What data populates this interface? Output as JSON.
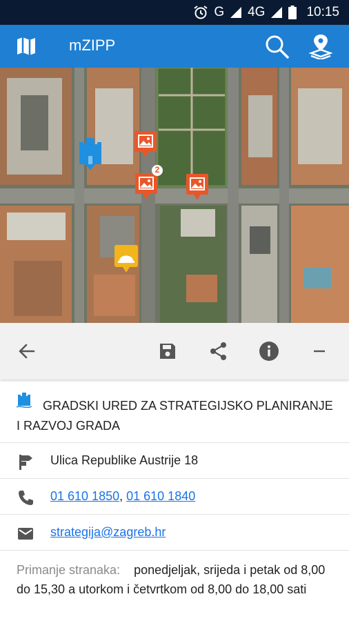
{
  "status_bar": {
    "network_g": "G",
    "network_4g": "4G",
    "time": "10:15"
  },
  "app_bar": {
    "title": "mZIPP",
    "icons": [
      "map-icon",
      "search-icon",
      "location-pin-icon"
    ]
  },
  "map": {
    "cluster_count": "2",
    "markers": [
      "building-marker-icon",
      "photo-marker-icon",
      "photo-cluster-marker-icon",
      "photo-marker-icon",
      "helmet-marker-icon"
    ]
  },
  "toolbar": {
    "icons": [
      "back-arrow-icon",
      "save-icon",
      "share-icon",
      "info-icon",
      "minimize-icon"
    ]
  },
  "details": {
    "org_name": "GRADSKI URED ZA STRATEGIJSKO PLANIRANJE I RAZVOJ GRADA",
    "address": "Ulica Republike Austrije 18",
    "phone_1": "01 610 1850",
    "phone_separator": ", ",
    "phone_2": "01 610 1840",
    "email": "strategija@zagreb.hr",
    "hours_label": "Primanje stranaka:",
    "hours_text": "ponedjeljak, srijeda i petak od 8,00 do 15,30 a utorkom i četvrtkom od 8,00 do 18,00 sati"
  },
  "colors": {
    "app_bar": "#1e7fd3",
    "status_bar": "#0a1a33",
    "link": "#1a73e8",
    "photo_marker": "#e8572a",
    "helmet_marker": "#f2b61c",
    "building_marker": "#1f8fe0"
  }
}
